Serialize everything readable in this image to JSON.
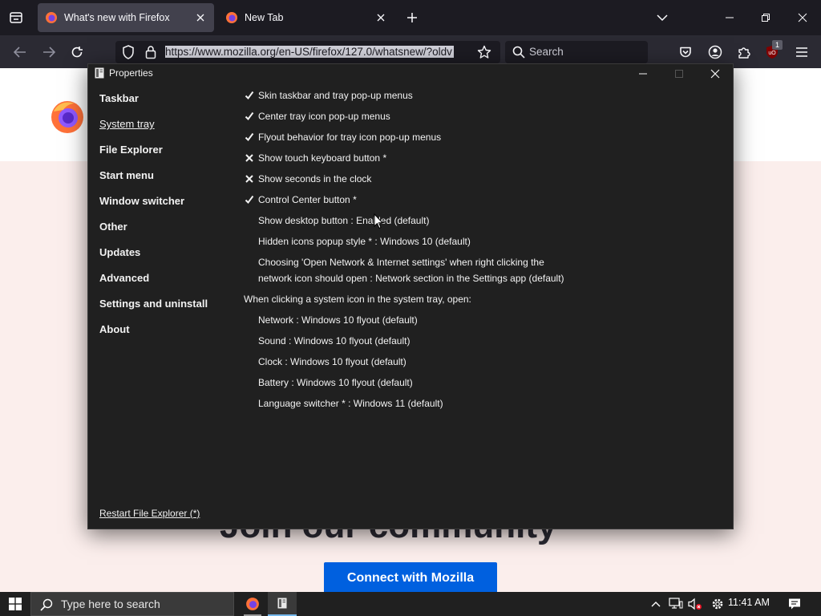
{
  "browser": {
    "tabs": [
      {
        "title": "What's new with Firefox",
        "active": true
      },
      {
        "title": "New Tab",
        "active": false
      }
    ],
    "url": "https://www.mozilla.org/en-US/firefox/127.0/whatsnew/?oldv",
    "search_placeholder": "Search",
    "ublock_badge": "1"
  },
  "page": {
    "heading_partial": "Join our community",
    "connect_button": "Connect with Mozilla"
  },
  "dialog": {
    "title": "Properties",
    "nav": [
      {
        "label": "Taskbar",
        "active": false
      },
      {
        "label": "System tray",
        "active": true
      },
      {
        "label": "File Explorer",
        "active": false
      },
      {
        "label": "Start menu",
        "active": false
      },
      {
        "label": "Window switcher",
        "active": false
      },
      {
        "label": "Other",
        "active": false
      },
      {
        "label": "Updates",
        "active": false
      },
      {
        "label": "Advanced",
        "active": false
      },
      {
        "label": "Settings and uninstall",
        "active": false
      },
      {
        "label": "About",
        "active": false
      }
    ],
    "restart_link": "Restart File Explorer (*)",
    "options": [
      {
        "text": "Skin taskbar and tray pop-up menus",
        "state": "checked"
      },
      {
        "text": "Center tray icon pop-up menus",
        "state": "checked"
      },
      {
        "text": "Flyout behavior for tray icon pop-up menus",
        "state": "checked"
      },
      {
        "text": "Show touch keyboard button *",
        "state": "unchecked"
      },
      {
        "text": "Show seconds in the clock",
        "state": "unchecked"
      },
      {
        "text": "Control Center button *",
        "state": "checked"
      },
      {
        "text": "Show desktop button : Enabled (default)",
        "state": "none"
      },
      {
        "text": "Hidden icons popup style * : Windows 10 (default)",
        "state": "none"
      },
      {
        "text": "Choosing 'Open Network & Internet settings' when right clicking the network icon should open : Network section in the Settings app (default)",
        "state": "none"
      }
    ],
    "section_label": "When clicking a system icon in the system tray, open:",
    "flyouts": [
      "Network : Windows 10 flyout (default)",
      "Sound : Windows 10 flyout (default)",
      "Clock : Windows 10 flyout (default)",
      "Battery : Windows 10 flyout (default)",
      "Language switcher * : Windows 11 (default)"
    ]
  },
  "taskbar": {
    "search_placeholder": "Type here to search",
    "clock": "11:41 AM"
  }
}
